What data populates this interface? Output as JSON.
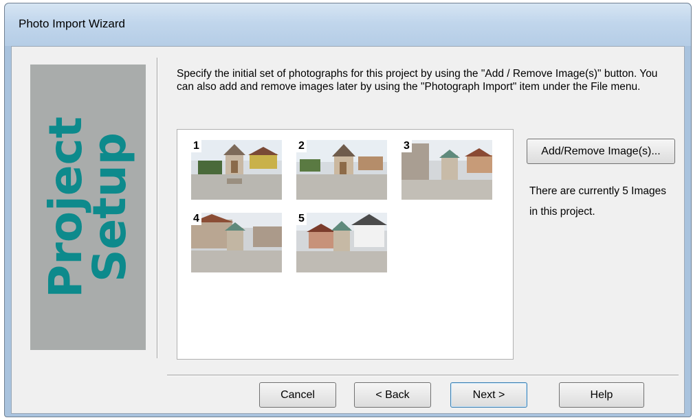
{
  "window": {
    "title": "Photo Import Wizard"
  },
  "side_panel": {
    "line1": "Project",
    "line2": "Setup"
  },
  "instructions": "Specify the initial set of photographs for this project by using the \"Add / Remove Image(s)\" button. You can also add and remove images later by using the \"Photograph Import\" item under the File menu.",
  "images": [
    {
      "number": "1"
    },
    {
      "number": "2"
    },
    {
      "number": "3"
    },
    {
      "number": "4"
    },
    {
      "number": "5"
    }
  ],
  "add_remove_label": "Add/Remove Image(s)...",
  "count_text": "There are currently 5 Images in this project.",
  "buttons": {
    "cancel": "Cancel",
    "back": "< Back",
    "next": "Next >",
    "help": "Help"
  },
  "colors": {
    "accent_text": "#0d8a8c",
    "side_panel_bg": "#a9acab"
  }
}
